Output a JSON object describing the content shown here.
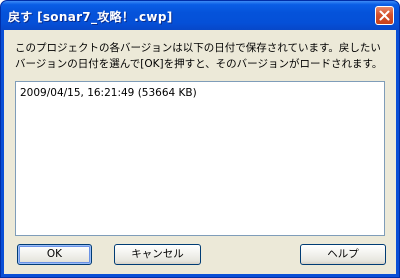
{
  "window": {
    "title": "戻す [sonar7_攻略！.cwp]",
    "close_icon": "close-icon"
  },
  "dialog": {
    "message": "このプロジェクトの各バージョンは以下の日付で保存されています。戻したいバージョンの日付を選んで[OK]を押すと、そのバージョンがロードされます。",
    "versions": [
      "2009/04/15, 16:21:49 (53664 KB)"
    ]
  },
  "buttons": {
    "ok": "OK",
    "cancel": "キャンセル",
    "help": "ヘルプ"
  },
  "colors": {
    "title_bar": "#0553da",
    "close_button": "#d5512c",
    "dialog_background": "#ece9d8",
    "button_border": "#003c74"
  }
}
